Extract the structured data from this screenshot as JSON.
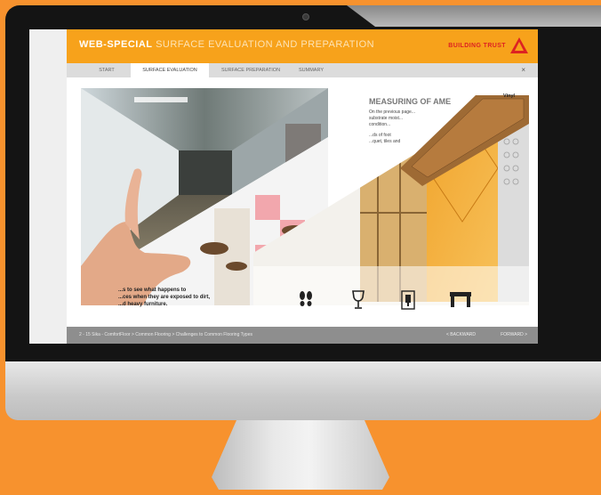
{
  "app": {
    "title_bold": "WEB-SPECIAL",
    "title_light": "SURFACE EVALUATION AND PREPARATION",
    "brand": "BUILDING TRUST",
    "logo_text": "SIKA"
  },
  "tabs": [
    {
      "label": "START"
    },
    {
      "label": "SURFACE EVALUATION"
    },
    {
      "label": "SURFACE PREPARATION"
    },
    {
      "label": "SUMMARY"
    }
  ],
  "close_label": "×",
  "content": {
    "measure_title": "MEASURING OF AME",
    "measure_body_1": "On the previous page...",
    "measure_body_2": "substrate moist...",
    "measure_body_3": "condition...",
    "measure_body_4": "...ds of foot",
    "measure_body_5": "...quet, tiles and",
    "vinyl_label": "Vinyl",
    "overlay_line_1": "...s to see what happens to",
    "overlay_line_2": "...ces when they are exposed to dirt,",
    "overlay_line_3": "...d heavy furniture."
  },
  "footer": {
    "breadcrumb": "2 - 15   Sika - ComfortFloor > Common Flooring > Challenges to Common Flooring Types",
    "back_label": "< BACKWARD",
    "forward_label": "FORWARD >"
  },
  "icons": [
    "footprints-icon",
    "wine-glass-icon",
    "heel-icon",
    "table-icon"
  ],
  "colors": {
    "accent": "#F7A21B",
    "background": "#F7922E",
    "brand_red": "#D22222"
  }
}
